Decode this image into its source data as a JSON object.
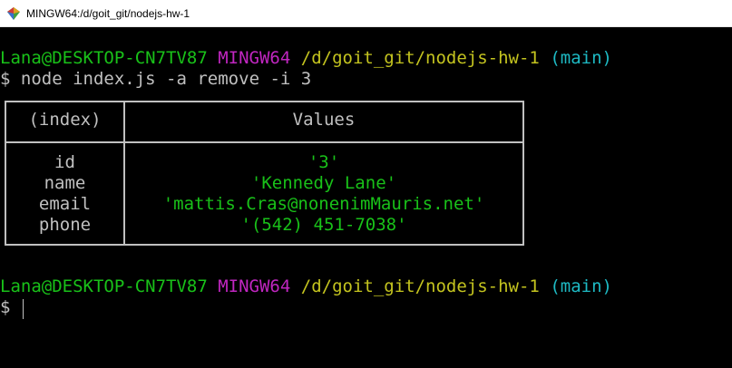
{
  "window": {
    "title": "MINGW64:/d/goit_git/nodejs-hw-1",
    "icon": "mingw-gem-icon"
  },
  "prompt": {
    "user_host": "Lana@DESKTOP-CN7TV87",
    "env": "MINGW64",
    "path": "/d/goit_git/nodejs-hw-1",
    "branch": "(main)",
    "symbol": "$"
  },
  "command": "node index.js -a remove -i 3",
  "table": {
    "headers": [
      "(index)",
      "Values"
    ],
    "rows": [
      {
        "key": "id",
        "value": "'3'"
      },
      {
        "key": "name",
        "value": "'Kennedy Lane'"
      },
      {
        "key": "email",
        "value": "'mattis.Cras@nonenimMauris.net'"
      },
      {
        "key": "phone",
        "value": "'(542) 451-7038'"
      }
    ]
  },
  "colors": {
    "background": "#000000",
    "user_host": "#19c119",
    "env": "#c026c0",
    "path": "#c4c41f",
    "branch": "#1ebac4",
    "text": "#c0c0c0",
    "value": "#19c119"
  }
}
